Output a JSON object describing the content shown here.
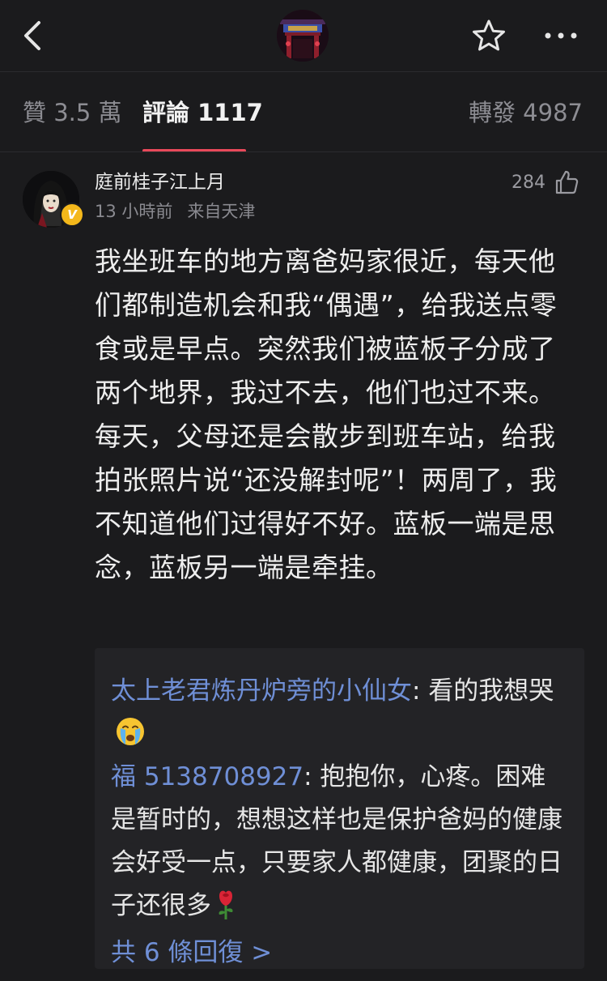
{
  "nav": {
    "back_icon": "chevron-left-icon",
    "favorite_icon": "star-outline-icon",
    "more_icon": "more-horizontal-icon"
  },
  "tabs": [
    {
      "label": "贊 3.5 萬"
    },
    {
      "label": "評論 1117"
    },
    {
      "label": "轉發 4987"
    }
  ],
  "comment": {
    "username": "庭前桂子江上月",
    "time": "13 小時前",
    "location": "来自天津",
    "likes": "284",
    "verified_badge": "V",
    "text": "我坐班车的地方离爸妈家很近，每天他们都制造机会和我“偶遇”，给我送点零食或是早点。突然我们被蓝板子分成了两个地界，我过不去，他们也过不来。每天，父母还是会散步到班车站，给我拍张照片说“还没解封呢”！两周了，我不知道他们过得好不好。蓝板一端是思念，蓝板另一端是牵挂。"
  },
  "replies": [
    {
      "name": "太上老君炼丹炉旁的小仙女",
      "sep": ": ",
      "text": "看的我想哭",
      "emoji": "crying-face-icon"
    },
    {
      "name": "福 5138708927",
      "sep": ": ",
      "text": "抱抱你，心疼。困难是暂时的，想想这样也是保护爸妈的健康会好受一点，只要家人都健康，团聚的日子还很多",
      "emoji": "rose-icon"
    }
  ],
  "more_replies": "共 6 條回復 >",
  "colors": {
    "background": "#1b1b1d",
    "accent": "#e8495a",
    "link": "#6f8fd6",
    "reply_box": "#232326"
  }
}
